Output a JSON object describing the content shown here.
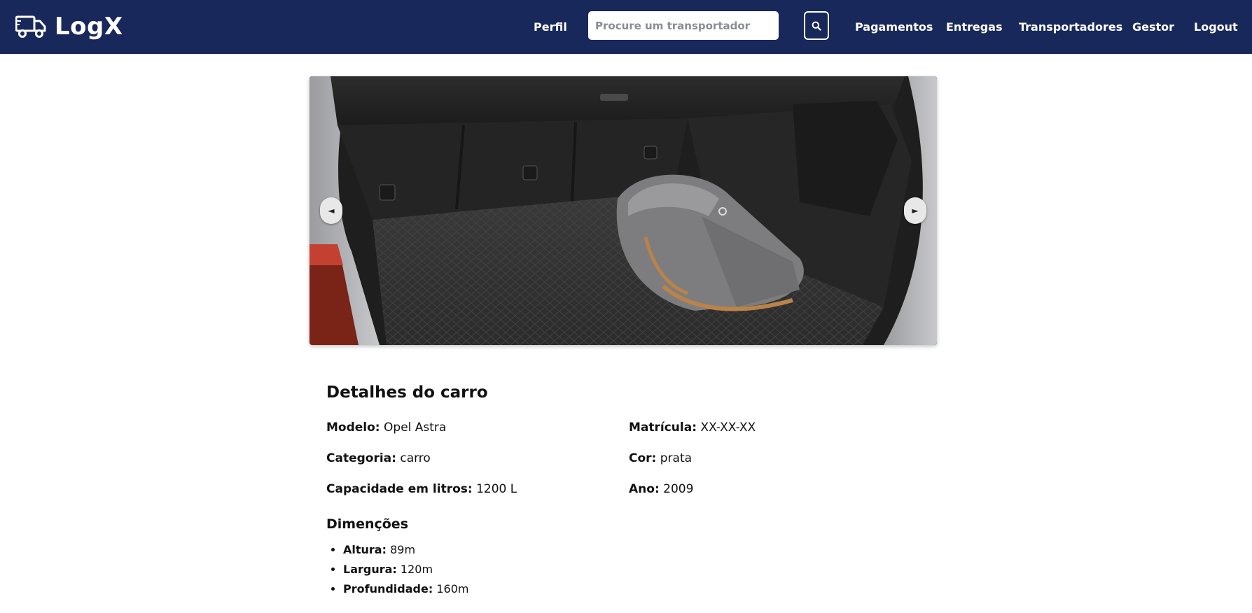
{
  "brand": {
    "name": "LogX",
    "icon": "truck-icon"
  },
  "nav": {
    "profile": "Perfil",
    "search_placeholder": "Procure um transportador",
    "search_icon": "search-icon",
    "payments": "Pagamentos",
    "deliveries": "Entregas",
    "carriers": "Transportadores",
    "manager": "Gestor",
    "logout": "Logout"
  },
  "carousel": {
    "prev": "◄",
    "next": "►"
  },
  "details": {
    "title": "Detalhes do carro",
    "model_label": "Modelo:",
    "model_value": "Opel Astra",
    "plate_label": "Matrícula:",
    "plate_value": "XX-XX-XX",
    "category_label": "Categoria:",
    "category_value": "carro",
    "color_label": "Cor:",
    "color_value": "prata",
    "capacity_label": "Capacidade em litros:",
    "capacity_value": "1200 L",
    "year_label": "Ano:",
    "year_value": "2009",
    "dimensions_title": "Dimenções",
    "height_label": "Altura:",
    "height_value": "89m",
    "width_label": "Largura:",
    "width_value": "120m",
    "depth_label": "Profundidade:",
    "depth_value": "160m"
  },
  "colors": {
    "navbar": "#19285a",
    "text": "#111111"
  }
}
